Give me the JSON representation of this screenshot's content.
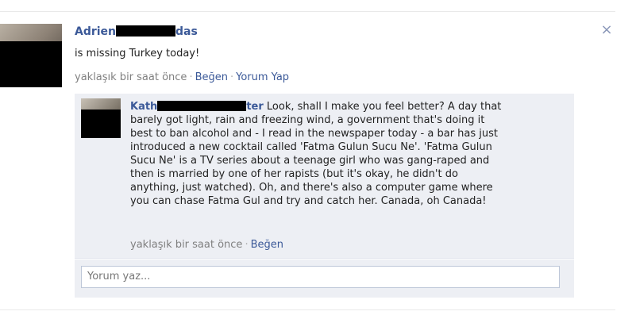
{
  "post": {
    "author_first": "Adrien",
    "author_last": "das",
    "text": "is missing Turkey today!",
    "time": "yaklaşık bir saat önce",
    "like_label": "Beğen",
    "comment_label": "Yorum Yap",
    "close_glyph": "×"
  },
  "comment": {
    "author_first": "Kath",
    "author_last": "ter",
    "lines": [
      "Look, shall I make you feel better? A day that",
      "barely got light, rain and freezing wind, a government that's doing it",
      "best to ban alcohol and - I read in the newspaper today - a bar has just",
      "introduced a new cocktail called 'Fatma Gulun Sucu Ne'. 'Fatma Gulun",
      "Sucu Ne' is a TV series about a teenage girl who was gang-raped and",
      "then is married by one of her rapists (but it's okay, he didn't do",
      "anything, just watched). Oh, and there's also a computer game where",
      "you can chase Fatma Gul and try and catch her. Canada, oh Canada!"
    ],
    "time": "yaklaşık bir saat önce",
    "like_label": "Beğen"
  },
  "reply": {
    "placeholder": "Yorum yaz..."
  },
  "separator": "·"
}
